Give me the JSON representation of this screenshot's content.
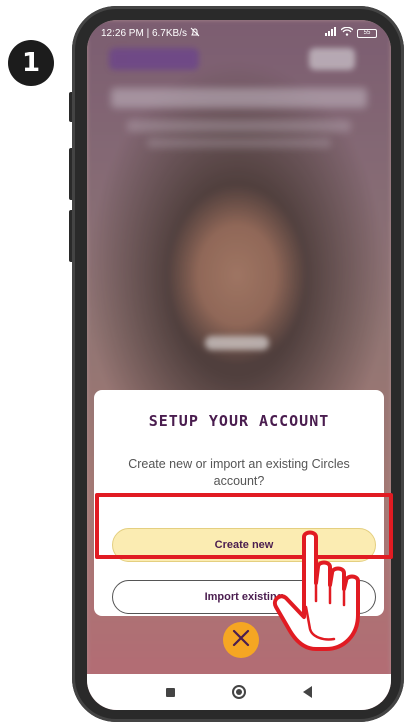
{
  "step": {
    "number": "1"
  },
  "status_bar": {
    "left_text": "12:26 PM | 6.7KB/s",
    "alarm_icon": "alarm-off-icon",
    "signal_icon": "signal-icon",
    "wifi_icon": "wifi-icon",
    "battery_text": "55"
  },
  "dialog": {
    "title": "SETUP YOUR ACCOUNT",
    "text": "Create new or import an existing Circles account?",
    "create_label": "Create new",
    "import_label": "Import existing"
  },
  "close_button": {
    "icon": "close-icon"
  },
  "nav_bar": {
    "recent_icon": "square-icon",
    "home_icon": "circle-icon",
    "back_icon": "back-triangle-icon"
  },
  "colors": {
    "dialog_title": "#4a1d4f",
    "create_button_bg": "#fbecb2",
    "highlight_border": "#e11b22",
    "close_button_bg": "#f5a623"
  }
}
